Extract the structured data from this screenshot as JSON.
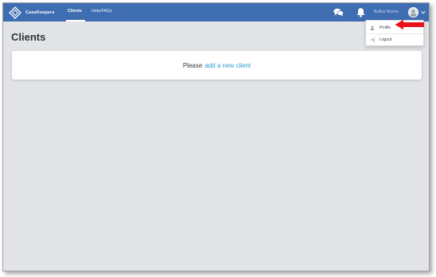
{
  "navbar": {
    "brand": "CaseKeepers",
    "links": [
      {
        "label": "Clients",
        "active": true
      },
      {
        "label": "Help/FAQs",
        "active": false
      }
    ],
    "icons": [
      "chat-icon",
      "bell-icon"
    ],
    "user_name": "Buffus Moore"
  },
  "page": {
    "title": "Clients"
  },
  "empty_state": {
    "prefix": "Please",
    "link": "add a new client"
  },
  "user_menu": {
    "items": [
      {
        "label": "Profile",
        "icon": "user-icon"
      },
      {
        "label": "Logout",
        "icon": "logout-icon"
      }
    ]
  },
  "annotation": {
    "arrow_color": "#e8101a",
    "points_to": "Profile"
  },
  "colors": {
    "navbar": "#3f6db1",
    "background": "#e2e4e7",
    "link": "#2e9bd6"
  }
}
